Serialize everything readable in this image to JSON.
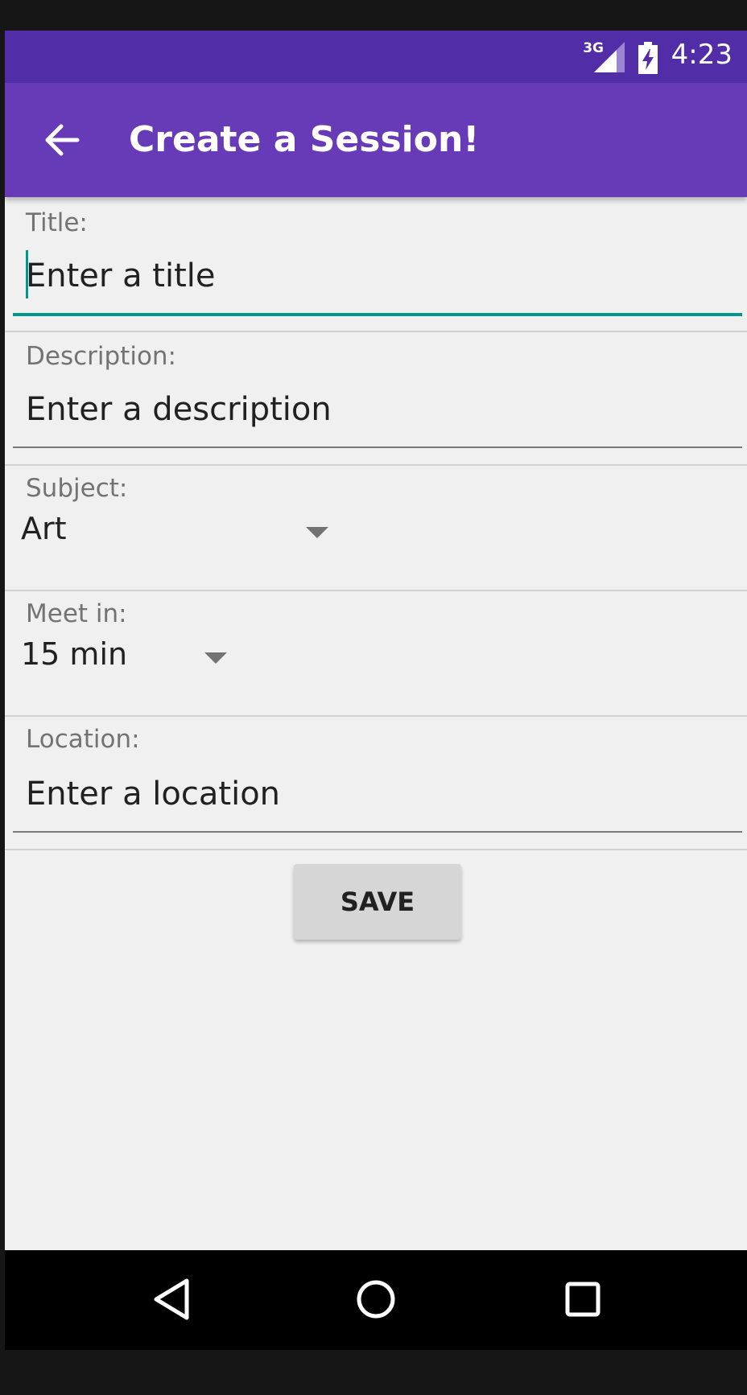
{
  "status_bar": {
    "network": "3G",
    "time": "4:23"
  },
  "app_bar": {
    "title": "Create a Session!"
  },
  "form": {
    "title": {
      "label": "Title:",
      "placeholder": "Enter a title",
      "value": ""
    },
    "description": {
      "label": "Description:",
      "placeholder": "Enter a description",
      "value": ""
    },
    "subject": {
      "label": "Subject:",
      "selected": "Art"
    },
    "meet_in": {
      "label": "Meet in:",
      "selected": "15 min"
    },
    "location": {
      "label": "Location:",
      "placeholder": "Enter a location",
      "value": ""
    },
    "save_label": "SAVE"
  },
  "colors": {
    "status_bar": "#512da8",
    "app_bar": "#673ab7",
    "accent": "#00968a",
    "background": "#f0f0f0"
  },
  "nav_bar": {
    "icons": [
      "back-triangle-icon",
      "home-circle-icon",
      "recents-square-icon"
    ]
  }
}
